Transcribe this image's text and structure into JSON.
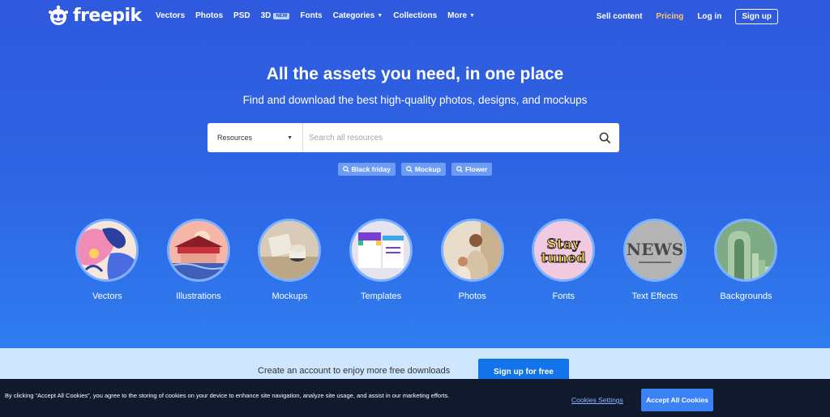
{
  "brand": {
    "name": "freepik"
  },
  "nav": {
    "links": [
      {
        "label": "Vectors"
      },
      {
        "label": "Photos"
      },
      {
        "label": "PSD"
      },
      {
        "label": "3D",
        "badge": "NEW"
      },
      {
        "label": "Fonts"
      },
      {
        "label": "Categories",
        "dropdown": true
      },
      {
        "label": "Collections"
      },
      {
        "label": "More",
        "dropdown": true
      }
    ],
    "sell": "Sell content",
    "pricing": "Pricing",
    "login": "Log in",
    "signup": "Sign up"
  },
  "hero": {
    "title": "All the assets you need, in one place",
    "subtitle": "Find and download the best high-quality photos, designs, and mockups"
  },
  "search": {
    "type_selected": "Resources",
    "placeholder": "Search all resources"
  },
  "tags": [
    "Black friday",
    "Mockup",
    "Flower"
  ],
  "categories": [
    {
      "label": "Vectors"
    },
    {
      "label": "Illustrations"
    },
    {
      "label": "Mockups"
    },
    {
      "label": "Templates"
    },
    {
      "label": "Photos"
    },
    {
      "label": "Fonts",
      "thumb_text_1": "Stay",
      "thumb_text_2": "tuned"
    },
    {
      "label": "Text Effects",
      "thumb_text": "NEWS"
    },
    {
      "label": "Backgrounds"
    }
  ],
  "banner": {
    "text": "Create an account to enjoy more free downloads",
    "button": "Sign up for free"
  },
  "cookie": {
    "text": "By clicking “Accept All Cookies”, you agree to the storing of cookies on your device to enhance site navigation, analyze site usage, and assist in our marketing efforts.",
    "settings": "Cookies Settings",
    "accept": "Accept All Cookies"
  },
  "colors": {
    "hero_bg": "#2f5de0",
    "accent": "#1273eb",
    "pricing": "#ffc36b",
    "cookie_bg": "#101a2c"
  }
}
